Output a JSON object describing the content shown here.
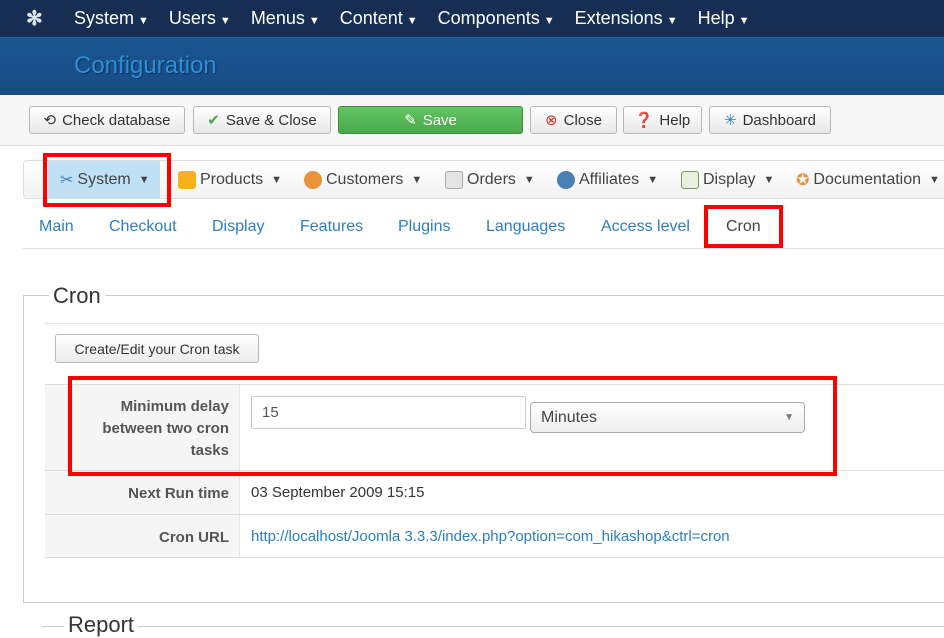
{
  "topnav": {
    "items": [
      "System",
      "Users",
      "Menus",
      "Content",
      "Components",
      "Extensions",
      "Help"
    ]
  },
  "header": {
    "title": "Configuration"
  },
  "toolbar": {
    "check_database": "Check database",
    "save_close": "Save & Close",
    "save": "Save",
    "close": "Close",
    "help": "Help",
    "dashboard": "Dashboard"
  },
  "submenu": {
    "items": [
      "System",
      "Products",
      "Customers",
      "Orders",
      "Affiliates",
      "Display",
      "Documentation"
    ]
  },
  "tabs": [
    "Main",
    "Checkout",
    "Display",
    "Features",
    "Plugins",
    "Languages",
    "Access level",
    "Cron"
  ],
  "cron": {
    "legend": "Cron",
    "create_button": "Create/Edit your Cron task",
    "min_delay_label": "Minimum delay between two cron tasks",
    "min_delay_value": "15",
    "min_delay_unit": "Minutes",
    "next_run_label": "Next Run time",
    "next_run_value": "03 September 2009 15:15",
    "cron_url_label": "Cron URL",
    "cron_url_value": "http://localhost/Joomla 3.3.3/index.php?option=com_hikashop&ctrl=cron"
  },
  "report": {
    "legend": "Report"
  },
  "colors": {
    "highlight": "#ff0000",
    "link": "#2a7fc1",
    "save": "#5cb85c",
    "topnav": "#172d52",
    "header": "#1a5590"
  }
}
